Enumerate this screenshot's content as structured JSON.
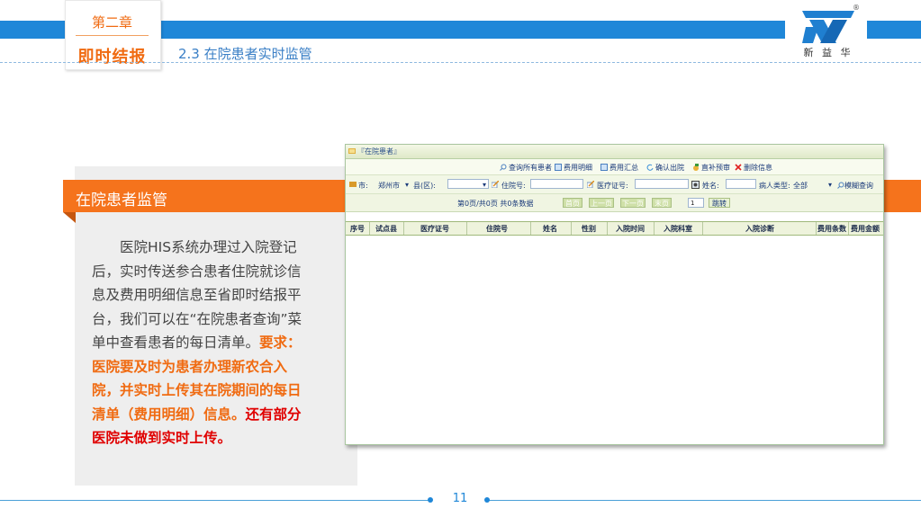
{
  "header": {
    "chapter": "第二章",
    "section_label": "即时结报",
    "section_title": "2.3 在院患者实时监管",
    "logo_text": "新 益 华",
    "logo_mark": "®"
  },
  "panel": {
    "title": "在院患者监管",
    "body_plain": "医院HIS系统办理过入院登记后，实时传送参合患者住院就诊信息及费用明细信息至省即时结报平台，我们可以在“在院患者查询”菜单中查看患者的每日清单。",
    "body_orange": "要求：医院要及时为患者办理新农合入院，并实时上传其在院期间的每日清单（费用明细）信息。",
    "body_red": "还有部分医院未做到实时上传。"
  },
  "app": {
    "tab_title": "『在院患者』",
    "toolbar": [
      {
        "label": "查询所有患者",
        "icon": "search-icon"
      },
      {
        "label": "费用明细",
        "icon": "doc-icon"
      },
      {
        "label": "费用汇总",
        "icon": "doc-icon"
      },
      {
        "label": "确认出院",
        "icon": "check-icon"
      },
      {
        "label": "直补预审",
        "icon": "money-icon"
      },
      {
        "label": "删除信息",
        "icon": "delete-icon"
      }
    ],
    "filters": {
      "city_label": "市:",
      "city_value": "郑州市",
      "county_label": "县(区):",
      "county_value": "",
      "inpatient_no_label": "住院号:",
      "medical_card_label": "医疗证号:",
      "name_label": "姓名:",
      "patient_type_label": "病人类型:",
      "patient_type_value": "全部",
      "fuzzy_search_label": "模糊查询"
    },
    "pager": {
      "info": "第0页/共0页 共0条数据",
      "first": "首页",
      "prev": "上一页",
      "next": "下一页",
      "last": "末页",
      "page_input": "1",
      "go": "跳转"
    },
    "columns": [
      "序号",
      "试点县",
      "医疗证号",
      "住院号",
      "姓名",
      "性别",
      "入院时间",
      "入院科室",
      "入院诊断",
      "费用条数",
      "费用金额"
    ]
  },
  "footer": {
    "page_number": "11"
  },
  "colors": {
    "accent_blue": "#1f87d8",
    "accent_orange": "#f5731c",
    "emphasis_red": "#e00000"
  }
}
